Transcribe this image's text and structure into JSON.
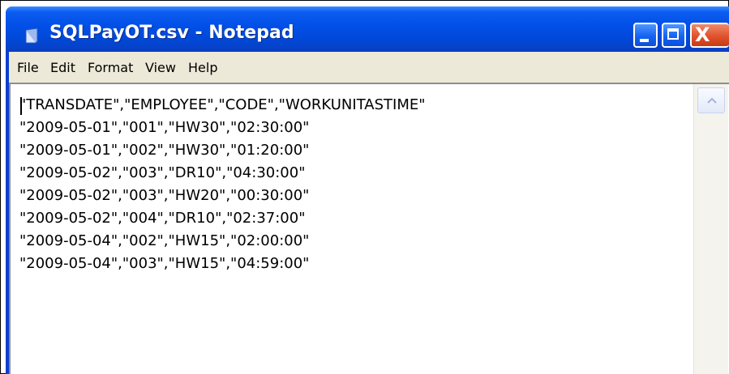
{
  "window": {
    "title": "SQLPayOT.csv - Notepad",
    "icon": "notepad-icon",
    "controls": {
      "minimize_icon": "minimize-icon",
      "maximize_icon": "maximize-icon",
      "close_glyph": "X"
    }
  },
  "menu": {
    "items": [
      "File",
      "Edit",
      "Format",
      "View",
      "Help"
    ]
  },
  "editor": {
    "lines": [
      "\"TRANSDATE\",\"EMPLOYEE\",\"CODE\",\"WORKUNITASTIME\"",
      "\"2009-05-01\",\"001\",\"HW30\",\"02:30:00\"",
      "\"2009-05-01\",\"002\",\"HW30\",\"01:20:00\"",
      "\"2009-05-02\",\"003\",\"DR10\",\"04:30:00\"",
      "\"2009-05-02\",\"003\",\"HW20\",\"00:30:00\"",
      "\"2009-05-02\",\"004\",\"DR10\",\"02:37:00\"",
      "\"2009-05-04\",\"002\",\"HW15\",\"02:00:00\"",
      "\"2009-05-04\",\"003\",\"HW15\",\"04:59:00\""
    ]
  },
  "colors": {
    "titlebar": "#0250e8",
    "close_button": "#e0522c",
    "menubar": "#ece9d8"
  }
}
